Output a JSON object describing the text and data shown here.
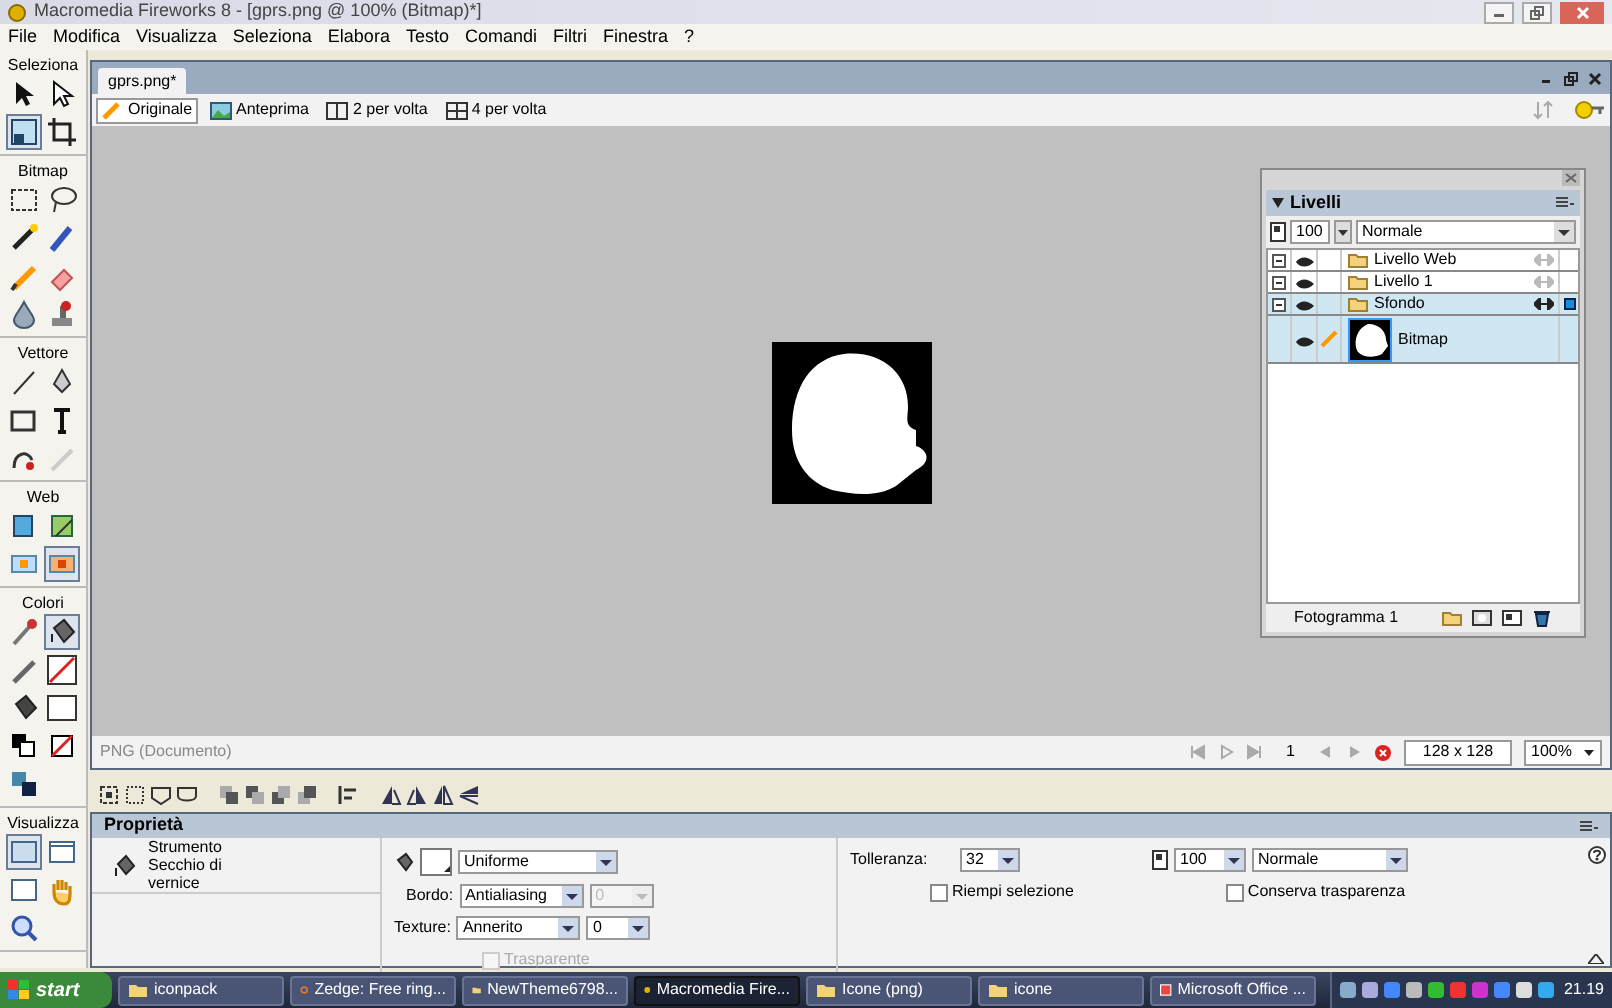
{
  "window": {
    "title": "Macromedia Fireworks 8 - [gprs.png @ 100% (Bitmap)*]"
  },
  "menu": [
    "File",
    "Modifica",
    "Visualizza",
    "Seleziona",
    "Elabora",
    "Testo",
    "Comandi",
    "Filtri",
    "Finestra",
    "?"
  ],
  "tools": [
    {
      "title": "Seleziona",
      "tools": [
        {
          "selected": false
        },
        {
          "selected": false
        },
        {
          "selected": true
        },
        {
          "selected": false
        }
      ]
    },
    {
      "title": "Bitmap",
      "tools": [
        {
          "selected": false
        },
        {
          "selected": false
        },
        {
          "selected": false
        },
        {
          "selected": false
        },
        {
          "selected": false
        },
        {
          "selected": false
        },
        {
          "selected": false
        },
        {
          "selected": false
        }
      ]
    },
    {
      "title": "Vettore",
      "tools": [
        {
          "selected": false
        },
        {
          "selected": false
        },
        {
          "selected": false
        },
        {
          "selected": false
        },
        {
          "selected": false
        },
        {
          "selected": false
        }
      ]
    },
    {
      "title": "Web",
      "tools": [
        {
          "selected": false
        },
        {
          "selected": false
        },
        {
          "selected": false
        },
        {
          "selected": true
        }
      ]
    },
    {
      "title": "Colori",
      "tools": [
        {
          "selected": false
        },
        {
          "selected": true
        },
        {
          "selected": false
        },
        {
          "selected": false
        },
        {
          "selected": false
        },
        {
          "selected": false
        },
        {
          "selected": false
        },
        {
          "selected": false
        },
        {
          "selected": false
        }
      ]
    },
    {
      "title": "Visualizza",
      "tools": [
        {
          "selected": true
        },
        {
          "selected": false
        },
        {
          "selected": false
        },
        {
          "selected": false
        },
        {
          "selected": false
        }
      ]
    }
  ],
  "document": {
    "tab": "gprs.png*",
    "views": [
      {
        "label": "Originale",
        "selected": true
      },
      {
        "label": "Anteprima",
        "selected": false
      },
      {
        "label": "2 per volta",
        "selected": false
      },
      {
        "label": "4 per volta",
        "selected": false
      }
    ],
    "status": "PNG (Documento)",
    "frame": "1",
    "size": "128 x 128",
    "zoom": "100%"
  },
  "layers_panel": {
    "title": "Livelli",
    "opacity": "100",
    "blend": "Normale",
    "layers": [
      {
        "name": "Livello Web",
        "expanded": true,
        "selected": false
      },
      {
        "name": "Livello 1",
        "expanded": true,
        "selected": false
      },
      {
        "name": "Sfondo",
        "expanded": true,
        "selected": true,
        "children": [
          {
            "name": "Bitmap",
            "selected": true
          }
        ]
      }
    ],
    "footer": "Fotogramma 1"
  },
  "properties": {
    "title": "Proprietà",
    "tool_name": "Strumento Secchio di vernice",
    "fill_type": "Uniforme",
    "edge_label": "Bordo:",
    "edge": "Antialiasing",
    "edge_amount": "0",
    "texture_label": "Texture:",
    "texture": "Annerito",
    "texture_amount": "0",
    "transparent": {
      "label": "Trasparente",
      "checked": false,
      "disabled": true
    },
    "tolerance_label": "Tolleranza:",
    "tolerance": "32",
    "fill_selection": {
      "label": "Riempi selezione",
      "checked": false,
      "disabled": false
    },
    "opacity": "100",
    "blend": "Normale",
    "preserve_transparency": {
      "label": "Conserva trasparenza",
      "checked": false,
      "disabled": false
    }
  },
  "taskbar": {
    "start": "start",
    "items": [
      {
        "label": "iconpack",
        "selected": false
      },
      {
        "label": "Zedge: Free ring...",
        "selected": false
      },
      {
        "label": "NewTheme6798...",
        "selected": false
      },
      {
        "label": "Macromedia Fire...",
        "selected": true
      },
      {
        "label": "Icone (png)",
        "selected": false
      },
      {
        "label": "icone",
        "selected": false
      },
      {
        "label": "Microsoft Office ...",
        "selected": false
      }
    ],
    "clock": "21.19"
  }
}
